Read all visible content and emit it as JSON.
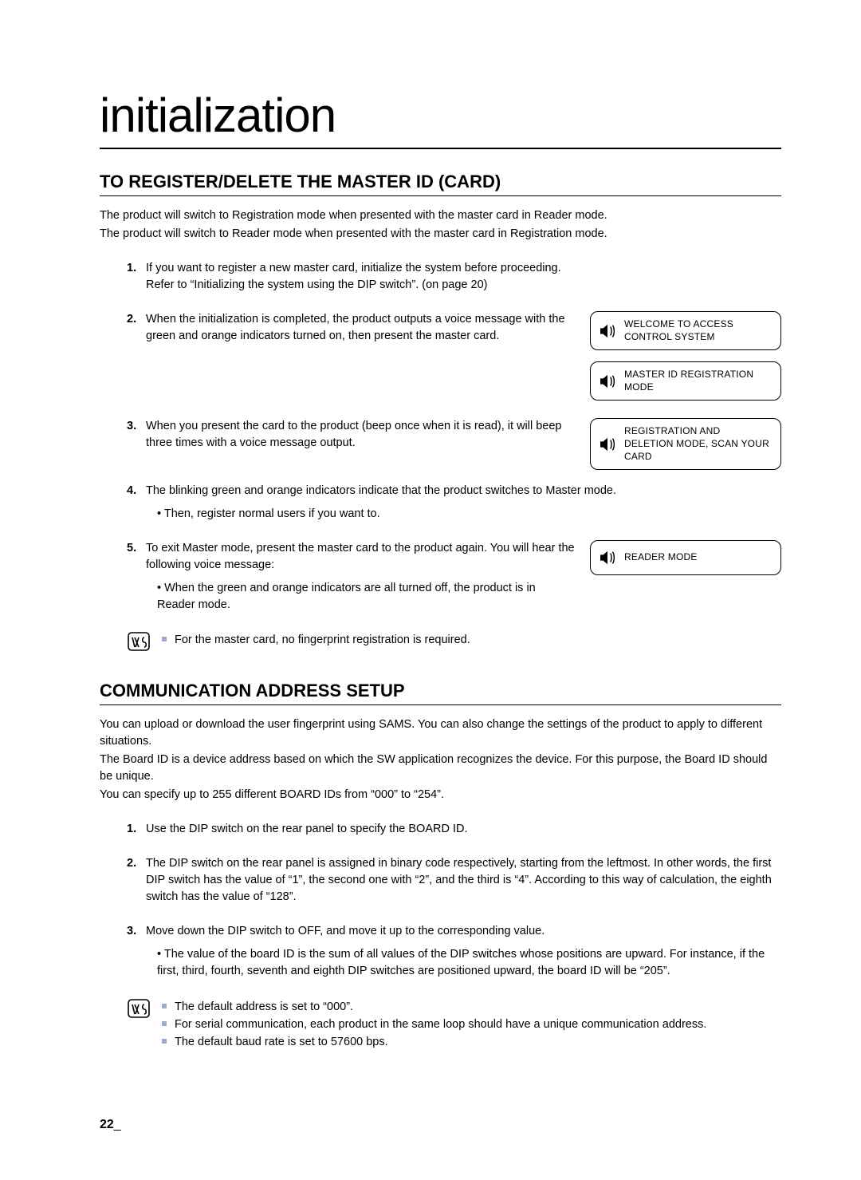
{
  "chapter_title": "initialization",
  "section1": {
    "heading": "TO REGISTER/DELETE THE MASTER ID (CARD)",
    "intro1": "The product will switch to Registration mode when presented with the master card in Reader mode.",
    "intro2": "The product will switch to Reader mode when presented with the master card in Registration mode.",
    "step1_num": "1.",
    "step1_a": "If you want to register a new master card, initialize the system before proceeding.",
    "step1_b": "Refer to “Initializing the system using the DIP switch”. (on page 20)",
    "step2_num": "2.",
    "step2": "When the initialization is completed, the product outputs a voice message with the green and orange indicators turned on, then present the master card.",
    "voice1": "WELCOME TO ACCESS CONTROL SYSTEM",
    "voice2": "MASTER ID REGISTRATION MODE",
    "step3_num": "3.",
    "step3": "When you present the card to the product (beep once when it is read), it will beep three times with a voice message output.",
    "voice3": "REGISTRATION AND DELETION MODE, SCAN YOUR CARD",
    "step4_num": "4.",
    "step4": "The blinking green and orange indicators indicate that the product switches to Master mode.",
    "step4_sub": "Then, register normal users if you want to.",
    "step5_num": "5.",
    "step5": "To exit Master mode, present the master card to the product again. You will hear the following voice message:",
    "step5_sub": "When the green and orange indicators are all turned off, the product is in Reader mode.",
    "voice4": "READER MODE",
    "note1": "For the master card, no fingerprint registration is required."
  },
  "section2": {
    "heading": "COMMUNICATION ADDRESS SETUP",
    "p1": "You can upload or download the user fingerprint using SAMS. You can also change the settings of the product to apply to different situations.",
    "p2": "The Board ID is a device address based on which the SW application recognizes the device. For this purpose, the Board ID should be unique.",
    "p3": "You can specify up to 255 different BOARD IDs from “000” to “254”.",
    "step1_num": "1.",
    "step1": "Use the DIP switch on the rear panel to specify the BOARD ID.",
    "step2_num": "2.",
    "step2": "The DIP switch on the rear panel is assigned in binary code respectively, starting from the leftmost. In other words, the first DIP switch has the value of “1”, the second one with “2”, and the third is “4”. According to this way of calculation, the eighth switch has the value of “128”.",
    "step3_num": "3.",
    "step3": "Move down the DIP switch to OFF, and move it up to the corresponding value.",
    "step3_sub": "The value of the board ID is the sum of all values of the DIP switches whose positions are upward. For instance, if the first, third, fourth, seventh and eighth DIP switches are positioned upward, the board ID will be “205”.",
    "note1": "The default address is set to “000”.",
    "note2": "For serial communication, each product in the same loop should have a unique communication address.",
    "note3": "The default baud rate is set to 57600 bps."
  },
  "page_number": "22",
  "page_underscore": "_"
}
